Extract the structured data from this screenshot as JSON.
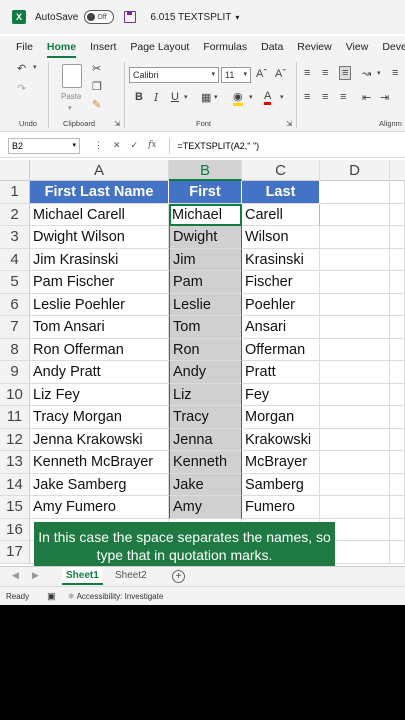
{
  "titlebar": {
    "autosave_label": "AutoSave",
    "toggle_state": "Off",
    "filename": "6.015 TEXTSPLIT"
  },
  "tabs": [
    "File",
    "Home",
    "Insert",
    "Page Layout",
    "Formulas",
    "Data",
    "Review",
    "View",
    "Develop"
  ],
  "active_tab": "Home",
  "ribbon": {
    "undo_label": "Undo",
    "clipboard_label": "Clipboard",
    "paste_label": "Paste",
    "font_label": "Font",
    "alignment_label": "Alignm",
    "font_name": "Calibri",
    "font_size": "11"
  },
  "formula_bar": {
    "name_box": "B2",
    "fx": "fx",
    "formula": "=TEXTSPLIT(A2,\" \")"
  },
  "columns": [
    "A",
    "B",
    "C",
    "D"
  ],
  "selected_column": "B",
  "header_row": {
    "row": "1",
    "a": "First Last Name",
    "b": "First",
    "c": "Last"
  },
  "rows": [
    {
      "row": "2",
      "a": "Michael Carell",
      "b": "Michael",
      "c": "Carell"
    },
    {
      "row": "3",
      "a": "Dwight Wilson",
      "b": "Dwight",
      "c": "Wilson"
    },
    {
      "row": "4",
      "a": "Jim Krasinski",
      "b": "Jim",
      "c": "Krasinski"
    },
    {
      "row": "5",
      "a": "Pam Fischer",
      "b": "Pam",
      "c": "Fischer"
    },
    {
      "row": "6",
      "a": "Leslie Poehler",
      "b": "Leslie",
      "c": "Poehler"
    },
    {
      "row": "7",
      "a": "Tom Ansari",
      "b": "Tom",
      "c": "Ansari"
    },
    {
      "row": "8",
      "a": "Ron Offerman",
      "b": "Ron",
      "c": "Offerman"
    },
    {
      "row": "9",
      "a": "Andy Pratt",
      "b": "Andy",
      "c": "Pratt"
    },
    {
      "row": "10",
      "a": "Liz Fey",
      "b": "Liz",
      "c": "Fey"
    },
    {
      "row": "11",
      "a": "Tracy Morgan",
      "b": "Tracy",
      "c": "Morgan"
    },
    {
      "row": "12",
      "a": "Jenna Krakowski",
      "b": "Jenna",
      "c": "Krakowski"
    },
    {
      "row": "13",
      "a": "Kenneth McBrayer",
      "b": "Kenneth",
      "c": "McBrayer"
    },
    {
      "row": "14",
      "a": "Jake Samberg",
      "b": "Jake",
      "c": "Samberg"
    },
    {
      "row": "15",
      "a": "Amy Fumero",
      "b": "Amy",
      "c": "Fumero"
    },
    {
      "row": "16",
      "a": "",
      "b": "",
      "c": ""
    },
    {
      "row": "17",
      "a": "",
      "b": "",
      "c": ""
    }
  ],
  "caption": "In this case the space separates the names, so type that in quotation marks.",
  "sheets": [
    "Sheet1",
    "Sheet2"
  ],
  "active_sheet": "Sheet1",
  "status": {
    "ready": "Ready",
    "accessibility": "Accessibility: Investigate"
  },
  "colors": {
    "excel_green": "#107c41",
    "header_blue": "#4472c4",
    "caption_green": "#1e7a42",
    "spill_gray": "#d0d0d0"
  }
}
